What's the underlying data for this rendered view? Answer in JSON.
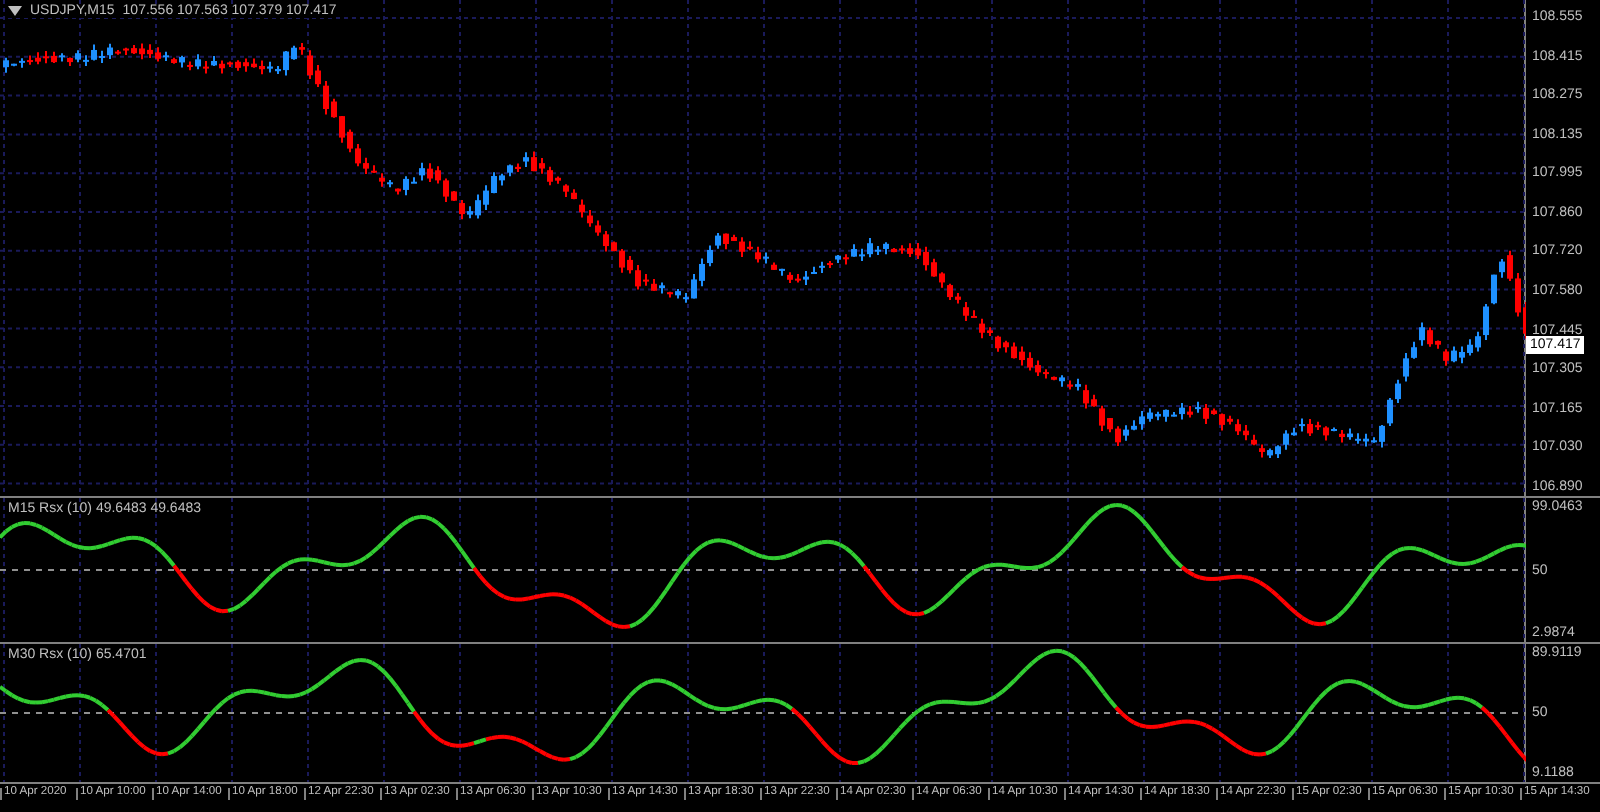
{
  "symbol_header": {
    "title": "USDJPY,M15",
    "ohlc": "107.556 107.563 107.379 107.417"
  },
  "price_axis": {
    "labels": [
      "108.555",
      "108.415",
      "108.275",
      "108.135",
      "107.995",
      "107.860",
      "107.720",
      "107.580",
      "107.445",
      "107.305",
      "107.165",
      "107.030",
      "106.890"
    ],
    "current_price": "107.417"
  },
  "indicators": [
    {
      "title": "M15 Rsx (10) 49.6483 49.6483",
      "axis": [
        "99.0463",
        "50",
        "2.9874"
      ]
    },
    {
      "title": "M30 Rsx (10) 65.4701",
      "axis": [
        "89.9119",
        "50",
        "9.1188"
      ]
    }
  ],
  "time_axis": [
    "10 Apr 2020",
    "10 Apr 10:00",
    "10 Apr 14:00",
    "10 Apr 18:00",
    "12 Apr 22:30",
    "13 Apr 02:30",
    "13 Apr 06:30",
    "13 Apr 10:30",
    "13 Apr 14:30",
    "13 Apr 18:30",
    "13 Apr 22:30",
    "14 Apr 02:30",
    "14 Apr 06:30",
    "14 Apr 10:30",
    "14 Apr 14:30",
    "14 Apr 18:30",
    "14 Apr 22:30",
    "15 Apr 02:30",
    "15 Apr 06:30",
    "15 Apr 10:30",
    "15 Apr 14:30"
  ]
}
